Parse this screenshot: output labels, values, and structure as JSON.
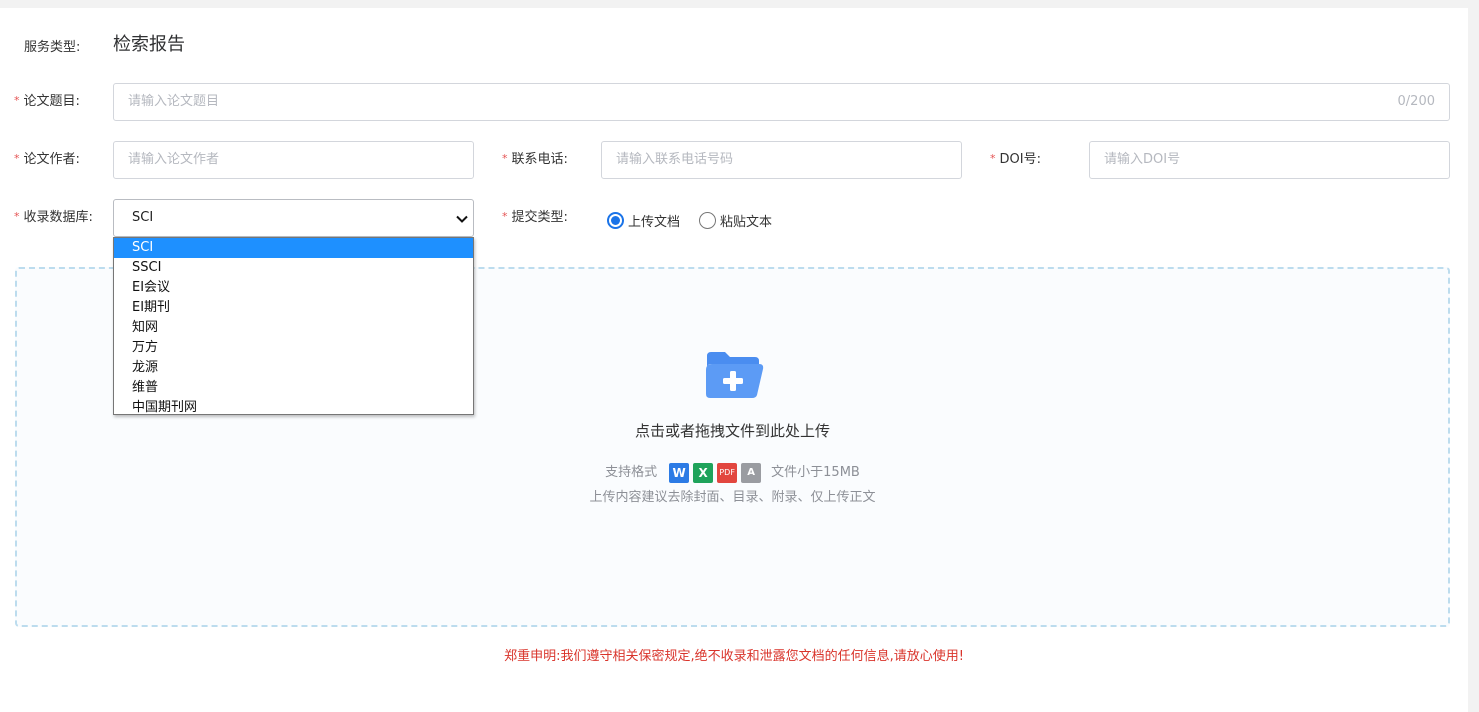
{
  "form": {
    "service_type": {
      "label": "服务类型:",
      "value": "检索报告"
    },
    "title": {
      "required_mark": "*",
      "label": "论文题目:",
      "placeholder": "请输入论文题目",
      "counter": "0/200"
    },
    "author": {
      "required_mark": "*",
      "label": "论文作者:",
      "placeholder": "请输入论文作者"
    },
    "phone": {
      "required_mark": "*",
      "label": "联系电话:",
      "placeholder": "请输入联系电话号码"
    },
    "doi": {
      "required_mark": "*",
      "label": "DOI号:",
      "placeholder": "请输入DOI号"
    },
    "database": {
      "required_mark": "*",
      "label": "收录数据库:",
      "selected": "SCI",
      "options": [
        "SCI",
        "SSCI",
        "EI会议",
        "EI期刊",
        "知网",
        "万方",
        "龙源",
        "维普",
        "中国期刊网"
      ]
    },
    "submit_type": {
      "required_mark": "*",
      "label": "提交类型:",
      "options": [
        {
          "label": "上传文档",
          "checked": true
        },
        {
          "label": "粘贴文本",
          "checked": false
        }
      ]
    }
  },
  "upload": {
    "main_text": "点击或者拖拽文件到此处上传",
    "formats_label": "支持格式",
    "format_icons": [
      "W",
      "X",
      "PDF",
      "A"
    ],
    "size_limit": "文件小于15MB",
    "tip": "上传内容建议去除封面、目录、附录、仅上传正文"
  },
  "disclaimer": "郑重申明:我们遵守相关保密规定,绝不收录和泄露您文档的任何信息,请放心使用!",
  "colors": {
    "primary": "#1a73e8",
    "required": "#e55353",
    "disclaimer": "#d9342b",
    "upload_border": "#bcdcee",
    "folder": "#4a8df0"
  }
}
